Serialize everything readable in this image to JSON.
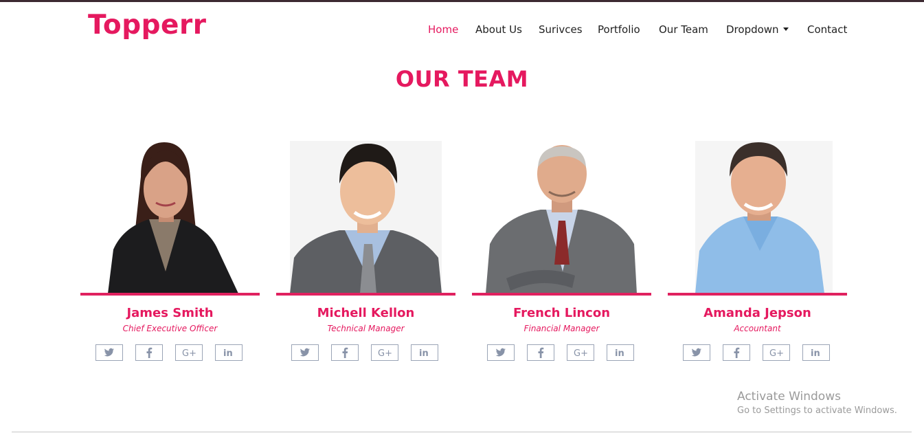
{
  "brand": {
    "logo": "Topperr",
    "accent_color": "#e5195f"
  },
  "nav": {
    "items": [
      {
        "label": "Home",
        "active": true
      },
      {
        "label": "About Us"
      },
      {
        "label": "Surivces"
      },
      {
        "label": "Portfolio"
      },
      {
        "label": "Our Team"
      },
      {
        "label": "Dropdown",
        "has_caret": true
      },
      {
        "label": "Contact"
      }
    ]
  },
  "section": {
    "title": "OUR TEAM"
  },
  "team": [
    {
      "name": "James Smith",
      "role": "Chief Executive Officer"
    },
    {
      "name": "Michell Kellon",
      "role": "Technical Manager"
    },
    {
      "name": "French Lincon",
      "role": "Financial Manager"
    },
    {
      "name": "Amanda Jepson",
      "role": "Accountant"
    }
  ],
  "social_icons": [
    "twitter-icon",
    "facebook-icon",
    "google-plus-icon",
    "linkedin-icon"
  ],
  "watermark": {
    "line1": "Activate Windows",
    "line2": "Go to Settings to activate Windows."
  }
}
